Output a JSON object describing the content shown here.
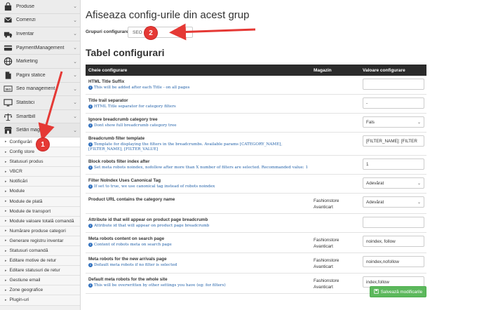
{
  "sidebar": {
    "items": [
      {
        "label": "Produse",
        "icon": "shopping-bag-icon"
      },
      {
        "label": "Comenzi",
        "icon": "envelope-icon"
      },
      {
        "label": "Inventar",
        "icon": "truck-icon"
      },
      {
        "label": "PaymentManagement",
        "icon": "credit-card-icon"
      },
      {
        "label": "Marketing",
        "icon": "globe-icon"
      },
      {
        "label": "Pagini statice",
        "icon": "document-icon"
      },
      {
        "label": "Seo management",
        "icon": "seo-icon"
      },
      {
        "label": "Statistici",
        "icon": "monitor-icon"
      },
      {
        "label": "Smartbill",
        "icon": "scale-icon"
      },
      {
        "label": "Setări magazin",
        "icon": "store-icon"
      }
    ],
    "subitems": [
      "Configurări",
      "Config store",
      "Statusuri produs",
      "VBCR",
      "Notificări",
      "Module",
      "Module de plată",
      "Module de transport",
      "Module valoare totală comandă",
      "Numărare produse categori",
      "Generare registru inventar",
      "Statusuri comandă",
      "Editare motive de retur",
      "Editare statusuri de retur",
      "Gestiune email",
      "Zone geografice",
      "Plugin-uri"
    ]
  },
  "main": {
    "title": "Afiseaza config-urile din acest grup",
    "group_label": "Grupuri configurare",
    "group_value": "SEO",
    "section_title": "Tabel configurari",
    "columns": [
      "Cheie configurare",
      "Magazin",
      "Valoare configurare"
    ],
    "rows": [
      {
        "key": "HTML Title Suffix",
        "desc": "This will be added after each Title - on all pages",
        "store": "",
        "value": "",
        "type": "input"
      },
      {
        "key": "Title trail separator",
        "desc": "HTML Title separator for category filters",
        "store": "",
        "value": "-",
        "type": "input"
      },
      {
        "key": "Ignore breadcrumb category tree",
        "desc": "Dont show full breadcrumb category tree",
        "store": "",
        "value": "Fals",
        "type": "select"
      },
      {
        "key": "Breadcrumb filter template",
        "desc": "Template for displaying the filters in the breadcrumbs. Available params [CATEGORY_NAME], [FILTER_NAME], [FILTER_VALUE]",
        "store": "",
        "value": "[FILTER_NAME]: [FILTER",
        "type": "input"
      },
      {
        "key": "Block robots filter index after",
        "desc": "Set meta robots noindex, nofollow after more than X number of filters are selected. Recommanded value: 1",
        "store": "",
        "value": "1",
        "type": "input"
      },
      {
        "key": "Filter NoIndex Uses Canonical Tag",
        "desc": "If set to true, we use canonical tag instead of robots noindex",
        "store": "",
        "value": "Adevărat",
        "type": "select"
      },
      {
        "key": "Product URL contains the category name",
        "desc": "",
        "store": "Fashionstore\nAvanticart",
        "value": "Adevărat",
        "type": "select"
      },
      {
        "key": "Attribute id that will appear on product page breadcrumb",
        "desc": "Attribute id that will appear on product page breadcrumb",
        "store": "",
        "value": "",
        "type": "input"
      },
      {
        "key": "Meta robots content on search page",
        "desc": "Content of robots meta on search page",
        "store": "Fashionstore\nAvanticart",
        "value": "noindex, follow",
        "type": "input"
      },
      {
        "key": "Meta robots for the new arrivals page",
        "desc": "Default meta robots if no filter is selected",
        "store": "Fashionstore\nAvanticart",
        "value": "noindex,nofollow",
        "type": "input"
      },
      {
        "key": "Default meta robots for the whole site",
        "desc": "This will be overwritten by other settings you have (eg: for filters)",
        "store": "Fashionstore\nAvanticart",
        "value": "index,follow",
        "type": "input"
      }
    ],
    "save_label": "Salvează modificarile"
  },
  "annotations": {
    "badge1": "1",
    "badge2": "2",
    "color": "#e53935"
  }
}
